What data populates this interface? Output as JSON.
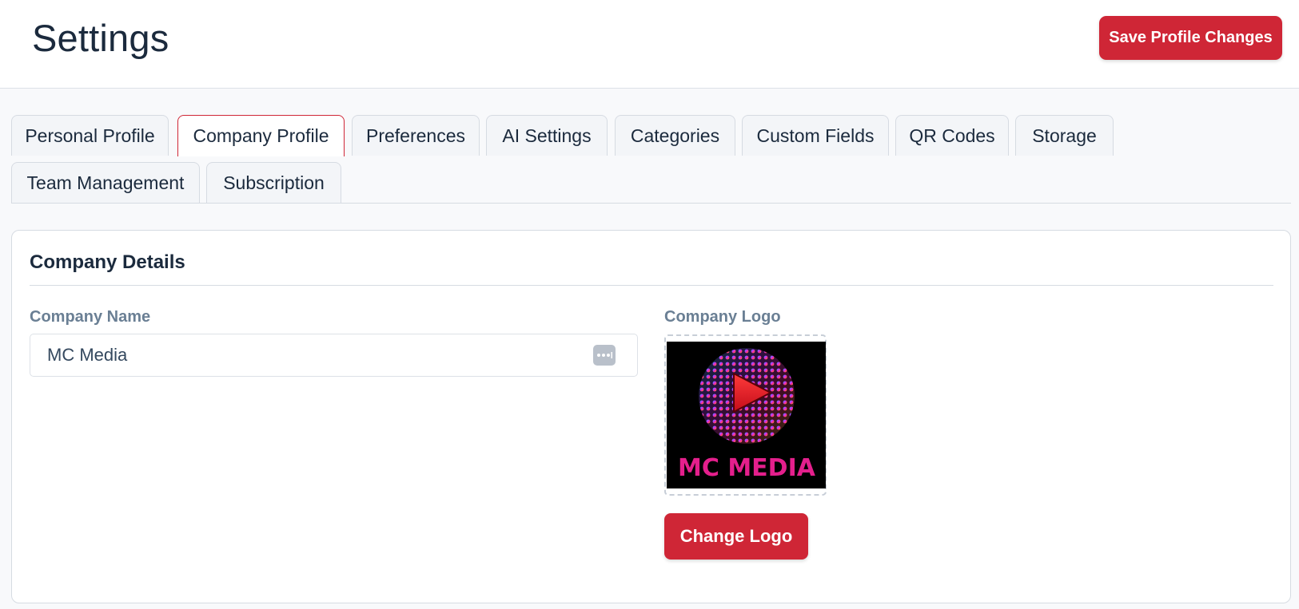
{
  "header": {
    "title": "Settings",
    "save_label": "Save Profile Changes"
  },
  "tabs": [
    {
      "label": "Personal Profile",
      "active": false
    },
    {
      "label": "Company Profile",
      "active": true
    },
    {
      "label": "Preferences",
      "active": false
    },
    {
      "label": "AI Settings",
      "active": false
    },
    {
      "label": "Categories",
      "active": false
    },
    {
      "label": "Custom Fields",
      "active": false
    },
    {
      "label": "QR Codes",
      "active": false
    },
    {
      "label": "Storage",
      "active": false
    },
    {
      "label": "Team Management",
      "active": false
    },
    {
      "label": "Subscription",
      "active": false
    }
  ],
  "company_details": {
    "title": "Company Details",
    "company_name_label": "Company Name",
    "company_name_value": "MC Media",
    "company_name_action_icon": "more-dots-icon",
    "logo_label": "Company Logo",
    "logo_text": "MC MEDIA",
    "change_logo_label": "Change Logo"
  },
  "colors": {
    "accent": "#cf2636",
    "text_dark": "#1b2a3d",
    "label_muted": "#6a7f94",
    "logo_pink": "#e41f8c"
  }
}
